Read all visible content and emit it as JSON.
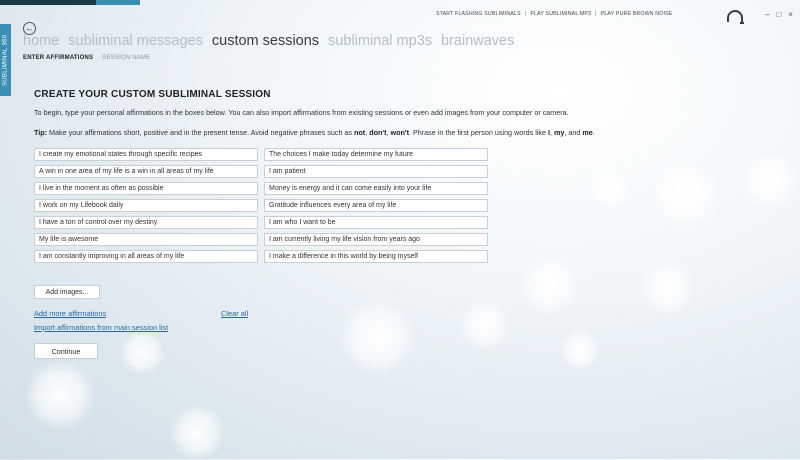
{
  "side_tab": "SUBLIMINAL 360",
  "top_links": [
    "START FLASHING SUBLIMINALS",
    "PLAY SUBLIMINAL MP3",
    "PLAY PURE BROWN NOISE"
  ],
  "window_controls": [
    "–",
    "□",
    "×"
  ],
  "nav": {
    "home": "home",
    "subliminal_messages": "subliminal messages",
    "custom_sessions": "custom sessions",
    "subliminal_mp3s": "subliminal mp3s",
    "brainwaves": "brainwaves"
  },
  "subnav": {
    "enter_affirmations": "ENTER AFFIRMATIONS",
    "session_name": "SESSION NAME"
  },
  "heading": "CREATE YOUR CUSTOM SUBLIMINAL SESSION",
  "intro": "To begin, type your personal affirmations in the boxes below. You can also import affirmations from existing sessions or even add images from your computer or camera.",
  "tip": {
    "label": "Tip:",
    "text1": " Make your affirmations short, positive and in the present tense. Avoid negative phrases such as ",
    "w1": "not",
    "c1": ", ",
    "w2": "don't",
    "c2": ", ",
    "w3": "won't",
    "text2": ". Phrase in the first person using words like ",
    "w4": "I",
    "c3": ", ",
    "w5": "my",
    "c4": ", and ",
    "w6": "me",
    "end": "."
  },
  "affirmations": [
    "I create my emotional states through specific recipes",
    "The choices I make today determine my future",
    "A win in one area of my life is a win in all areas of my life",
    "I am patient",
    "I live in the moment as often as possible",
    "Money is energy and it can come easily into your life",
    "I work on my Lifebook daily",
    "Gratitude influences every area of my life",
    "I have a ton of control over my destiny",
    "I am who I want to be",
    "My life is awesome",
    "I am currently living my life vision from years ago",
    "I am constantly improving in all areas of my life",
    "I make a difference in this world by being myself"
  ],
  "buttons": {
    "add_images": "Add images...",
    "continue": "Continue"
  },
  "links": {
    "add_more": "Add more affirmations",
    "clear_all": "Clear all",
    "import": "Import affirmations from main session list"
  }
}
